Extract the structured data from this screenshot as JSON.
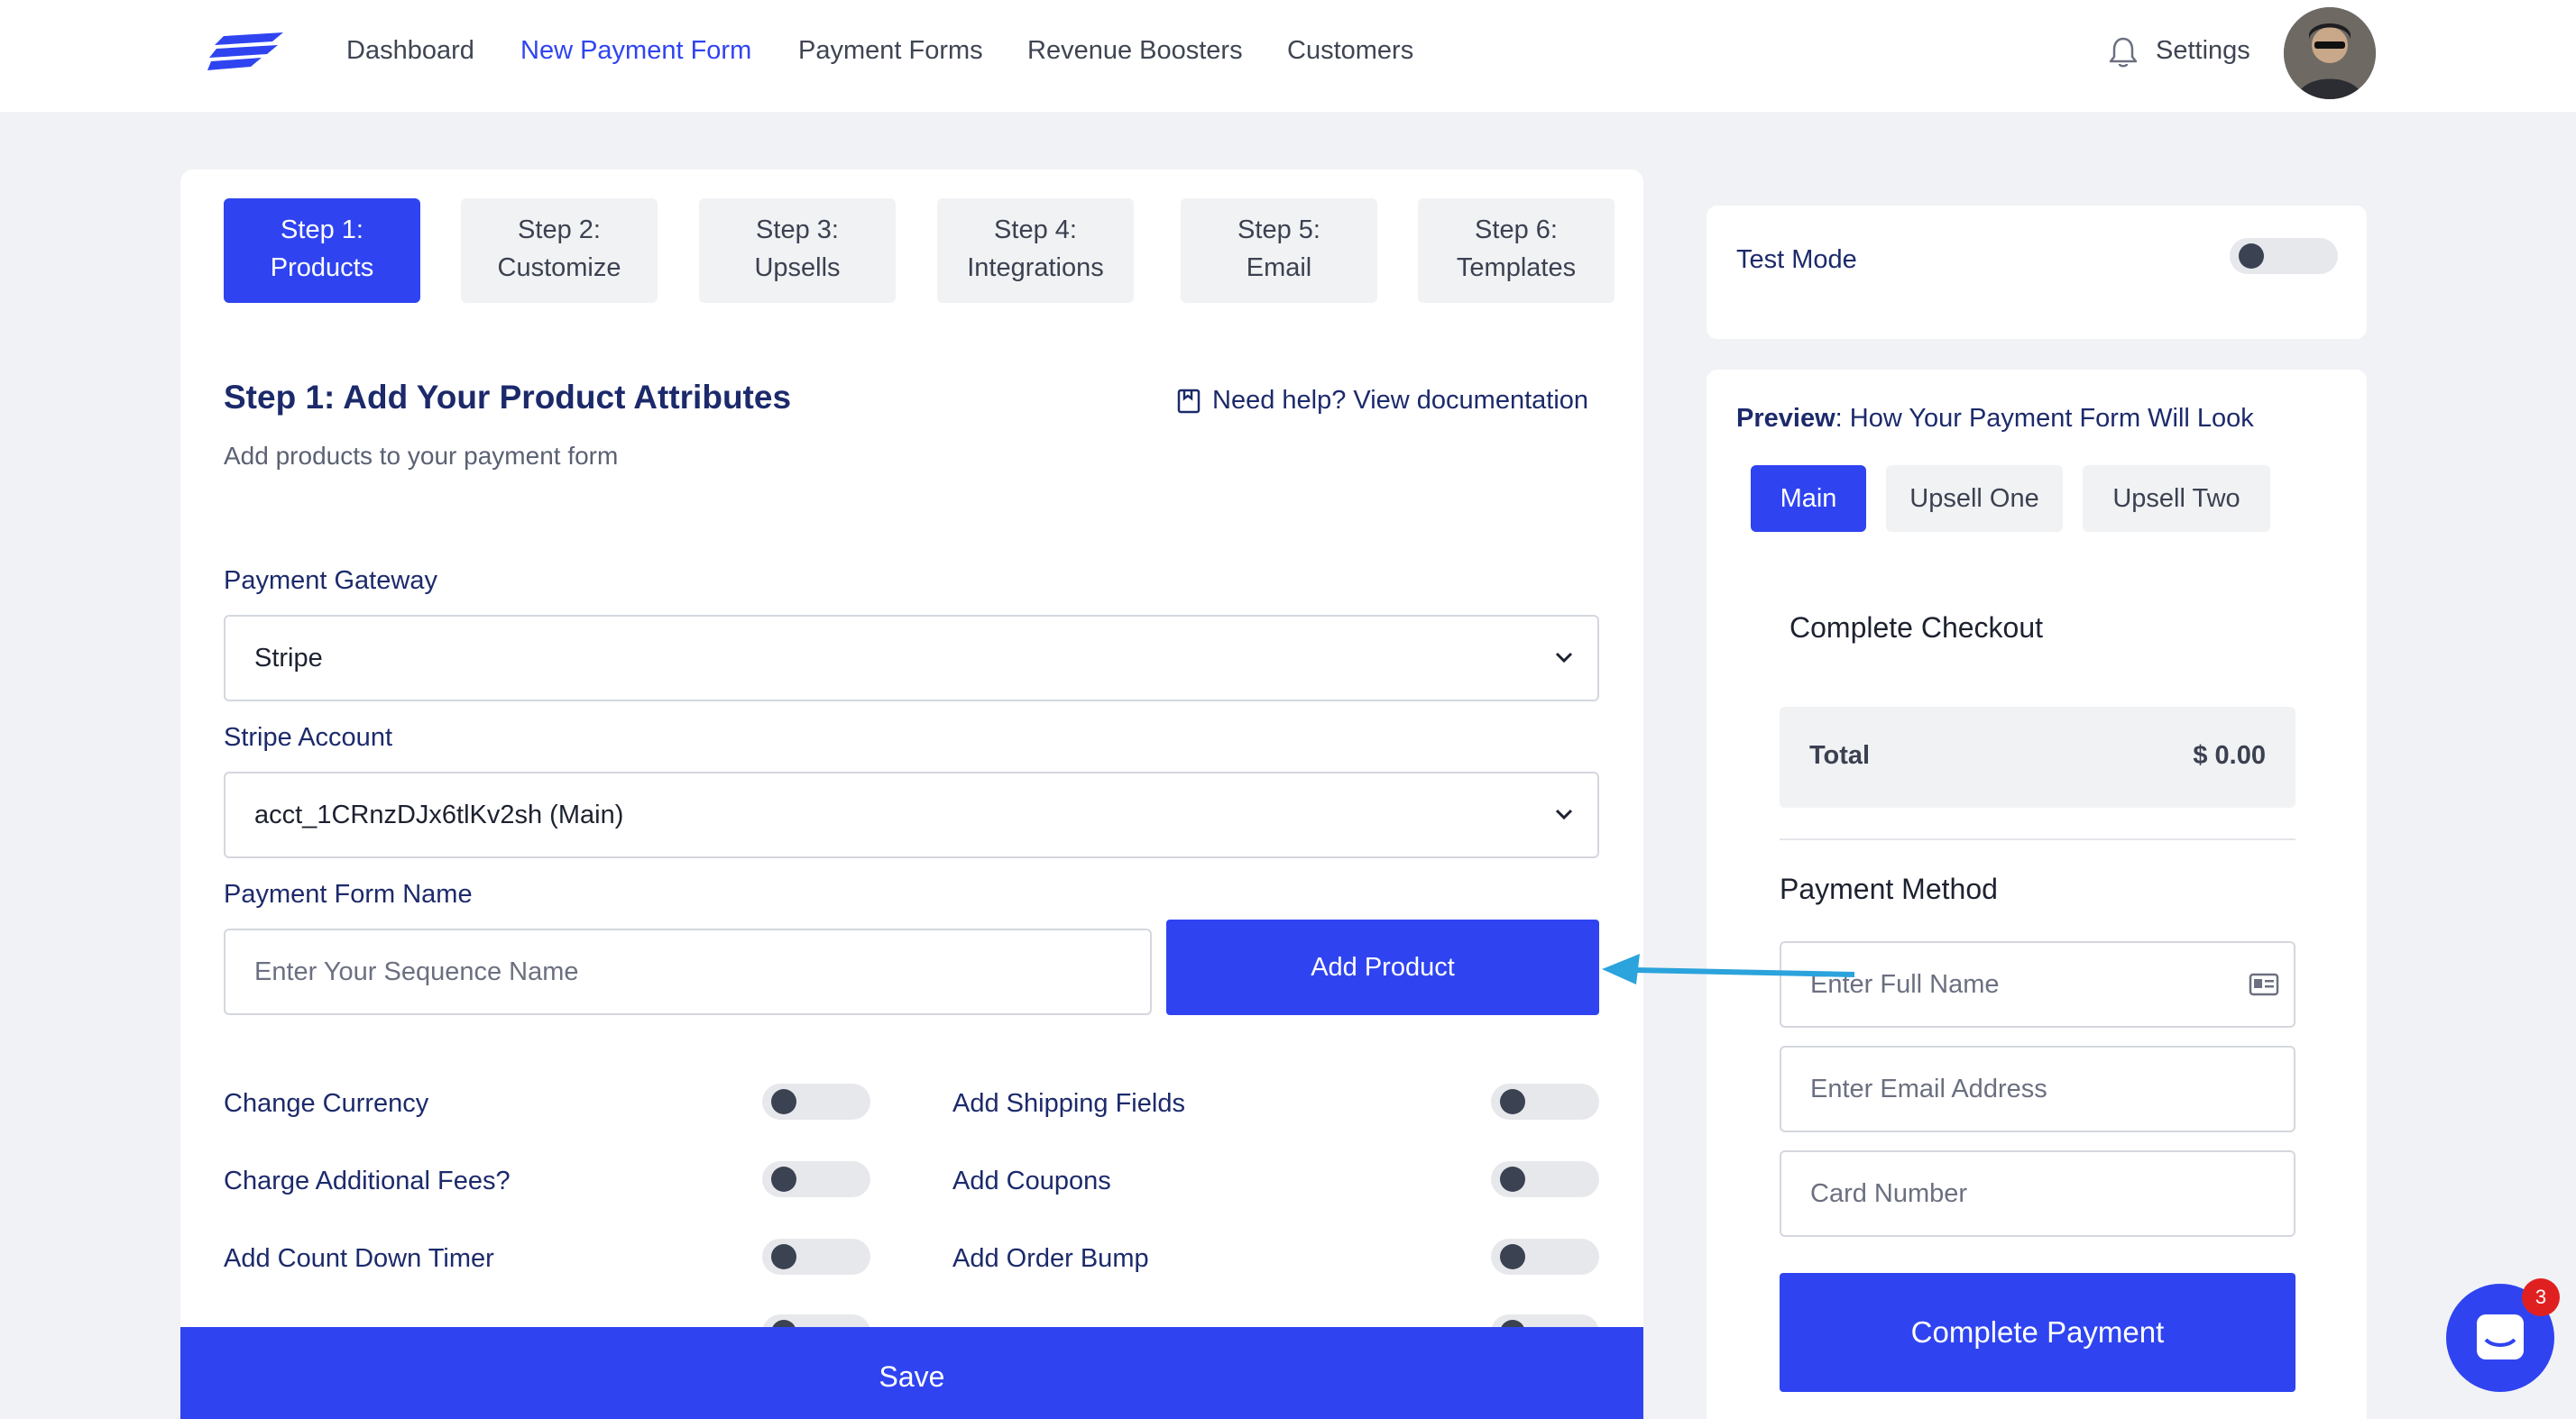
{
  "header": {
    "nav": [
      "Dashboard",
      "New Payment Form",
      "Payment Forms",
      "Revenue Boosters",
      "Customers"
    ],
    "active_nav": "New Payment Form",
    "settings_label": "Settings"
  },
  "steps": [
    {
      "line1": "Step 1:",
      "line2": "Products"
    },
    {
      "line1": "Step 2:",
      "line2": "Customize"
    },
    {
      "line1": "Step 3:",
      "line2": "Upsells"
    },
    {
      "line1": "Step 4:",
      "line2": "Integrations"
    },
    {
      "line1": "Step 5:",
      "line2": "Email"
    },
    {
      "line1": "Step 6:",
      "line2": "Templates"
    }
  ],
  "section": {
    "title": "Step 1: Add Your Product Attributes",
    "subtitle": "Add products to your payment form",
    "help_link": "Need help? View documentation"
  },
  "form": {
    "gateway_label": "Payment Gateway",
    "gateway_value": "Stripe",
    "account_label": "Stripe Account",
    "account_value": "acct_1CRnzDJx6tlKv2sh (Main)",
    "name_label": "Payment Form Name",
    "name_placeholder": "Enter Your Sequence Name",
    "add_product_label": "Add Product"
  },
  "toggles_left": [
    "Change Currency",
    "Charge Additional Fees?",
    "Add Count Down Timer"
  ],
  "toggles_right": [
    "Add Shipping Fields",
    "Add Coupons",
    "Add Order Bump"
  ],
  "save_label": "Save",
  "test_mode": {
    "label": "Test Mode",
    "enabled": false
  },
  "preview": {
    "title_bold": "Preview",
    "title_rest": ": How Your Payment Form Will Look",
    "tabs": [
      "Main",
      "Upsell One",
      "Upsell Two"
    ],
    "checkout_title": "Complete Checkout",
    "total_label": "Total",
    "total_value": "$ 0.00",
    "payment_method_title": "Payment Method",
    "full_name_placeholder": "Enter Full Name",
    "email_placeholder": "Enter Email Address",
    "card_placeholder": "Card Number",
    "complete_label": "Complete Payment"
  },
  "chat": {
    "badge_count": "3"
  },
  "colors": {
    "accent": "#2f44f0",
    "navy": "#1c2a6b",
    "annotation_arrow": "#2ba3dc"
  }
}
